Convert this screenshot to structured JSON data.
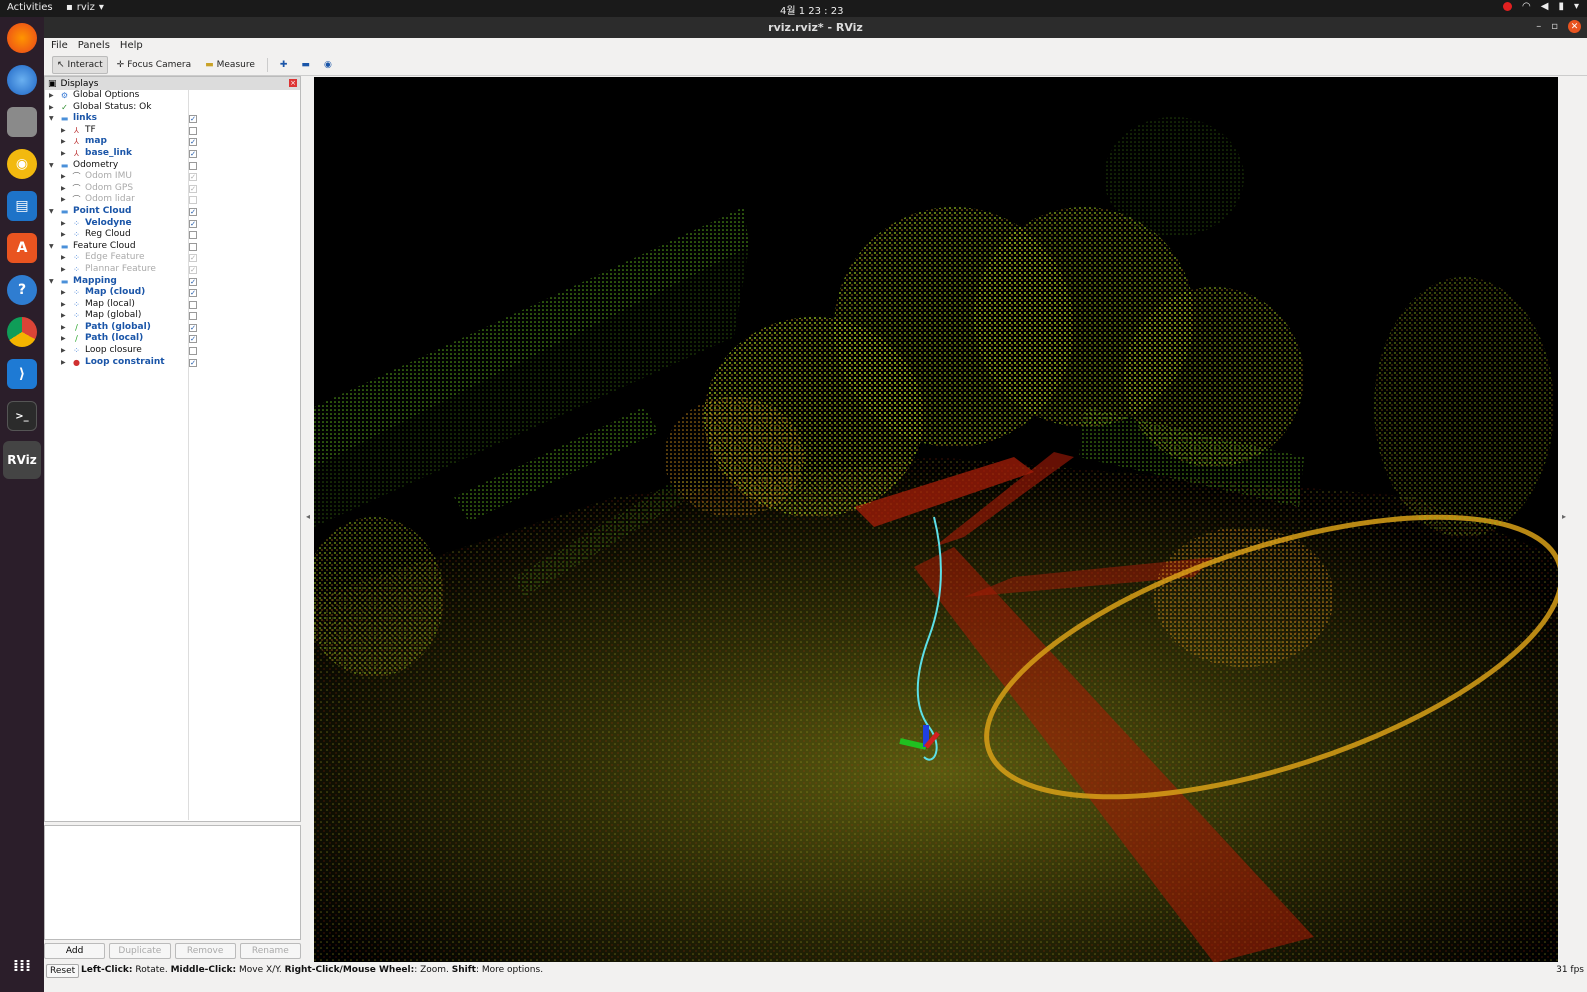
{
  "topbar": {
    "activities": "Activities",
    "app_name": "rviz",
    "clock": "4월 1  23 : 23"
  },
  "window": {
    "title": "rviz.rviz* - RViz"
  },
  "menu": {
    "file": "File",
    "panels": "Panels",
    "help": "Help"
  },
  "toolbar": {
    "interact": "Interact",
    "focus_camera": "Focus Camera",
    "measure": "Measure"
  },
  "displays_panel": {
    "title": "Displays",
    "items": [
      {
        "label": "Global Options",
        "indent": 0,
        "checked": null,
        "style": "normal",
        "icon": "gear-icon"
      },
      {
        "label": "Global Status: Ok",
        "indent": 0,
        "checked": null,
        "style": "normal",
        "icon": "check-icon"
      },
      {
        "label": "links",
        "indent": 0,
        "checked": true,
        "style": "blue",
        "icon": "folder-icon",
        "expanded": true
      },
      {
        "label": "TF",
        "indent": 1,
        "checked": false,
        "style": "normal",
        "icon": "axes-icon"
      },
      {
        "label": "map",
        "indent": 1,
        "checked": true,
        "style": "blue",
        "icon": "axes-icon"
      },
      {
        "label": "base_link",
        "indent": 1,
        "checked": true,
        "style": "blue",
        "icon": "axes-icon"
      },
      {
        "label": "Odometry",
        "indent": 0,
        "checked": false,
        "style": "normal",
        "icon": "folder-icon",
        "expanded": true
      },
      {
        "label": "Odom IMU",
        "indent": 1,
        "checked": true,
        "style": "grey",
        "icon": "odometry-icon"
      },
      {
        "label": "Odom GPS",
        "indent": 1,
        "checked": true,
        "style": "grey",
        "icon": "odometry-icon"
      },
      {
        "label": "Odom lidar",
        "indent": 1,
        "checked": false,
        "style": "grey",
        "icon": "odometry-icon"
      },
      {
        "label": "Point Cloud",
        "indent": 0,
        "checked": true,
        "style": "blue",
        "icon": "folder-icon",
        "expanded": true
      },
      {
        "label": "Velodyne",
        "indent": 1,
        "checked": true,
        "style": "blue",
        "icon": "pointcloud-icon"
      },
      {
        "label": "Reg Cloud",
        "indent": 1,
        "checked": false,
        "style": "normal",
        "icon": "pointcloud-icon"
      },
      {
        "label": "Feature Cloud",
        "indent": 0,
        "checked": false,
        "style": "normal",
        "icon": "folder-icon",
        "expanded": true
      },
      {
        "label": "Edge Feature",
        "indent": 1,
        "checked": true,
        "style": "grey",
        "icon": "pointcloud-icon"
      },
      {
        "label": "Plannar Feature",
        "indent": 1,
        "checked": true,
        "style": "grey",
        "icon": "pointcloud-icon"
      },
      {
        "label": "Mapping",
        "indent": 0,
        "checked": true,
        "style": "blue",
        "icon": "folder-icon",
        "expanded": true
      },
      {
        "label": "Map (cloud)",
        "indent": 1,
        "checked": true,
        "style": "blue",
        "icon": "pointcloud-icon"
      },
      {
        "label": "Map (local)",
        "indent": 1,
        "checked": false,
        "style": "normal",
        "icon": "pointcloud-icon"
      },
      {
        "label": "Map (global)",
        "indent": 1,
        "checked": false,
        "style": "normal",
        "icon": "pointcloud-icon"
      },
      {
        "label": "Path (global)",
        "indent": 1,
        "checked": true,
        "style": "blue",
        "icon": "path-icon"
      },
      {
        "label": "Path (local)",
        "indent": 1,
        "checked": true,
        "style": "blue",
        "icon": "path-icon"
      },
      {
        "label": "Loop closure",
        "indent": 1,
        "checked": false,
        "style": "normal",
        "icon": "pointcloud-icon"
      },
      {
        "label": "Loop constraint",
        "indent": 1,
        "checked": true,
        "style": "blue",
        "icon": "marker-icon"
      }
    ],
    "buttons": {
      "add": "Add",
      "duplicate": "Duplicate",
      "remove": "Remove",
      "rename": "Rename"
    }
  },
  "statusbar": {
    "reset": "Reset",
    "help_left_click": "Left-Click:",
    "help_rotate": " Rotate. ",
    "help_middle_click": "Middle-Click:",
    "help_move": " Move X/Y. ",
    "help_right_click": "Right-Click/Mouse Wheel:",
    "help_zoom": ": Zoom. ",
    "help_shift": "Shift",
    "help_more": ": More options.",
    "fps": "31 fps"
  },
  "colors": {
    "accent_blue": "#1a55a8",
    "ubuntu_orange": "#e95420",
    "viewport_bg": "#000000"
  }
}
